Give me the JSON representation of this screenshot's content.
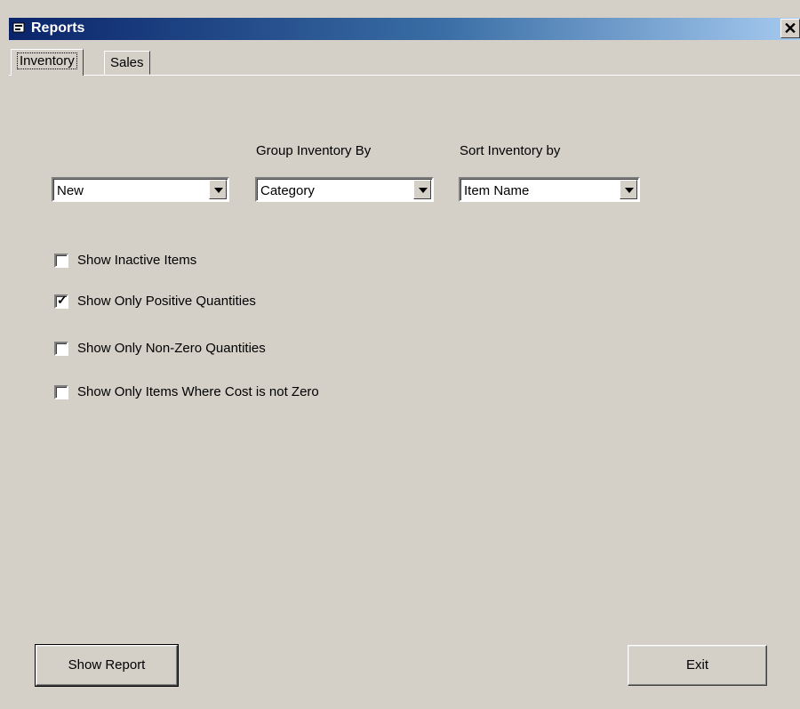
{
  "window": {
    "title": "Reports",
    "close_label": "✕"
  },
  "tabs": [
    {
      "label": "Inventory",
      "active": true
    },
    {
      "label": "Sales",
      "active": false
    }
  ],
  "form": {
    "report_type": {
      "label": "",
      "value": "New"
    },
    "group_by": {
      "label": "Group Inventory By",
      "value": "Category"
    },
    "sort_by": {
      "label": "Sort Inventory by",
      "value": "Item Name"
    },
    "options": [
      {
        "label": "Show Inactive Items",
        "checked": false
      },
      {
        "label": "Show Only Positive Quantities",
        "checked": true
      },
      {
        "label": "Show Only Non-Zero Quantities",
        "checked": false
      },
      {
        "label": "Show Only Items Where Cost is not Zero",
        "checked": false
      }
    ]
  },
  "buttons": {
    "show_report": "Show Report",
    "exit": "Exit"
  }
}
